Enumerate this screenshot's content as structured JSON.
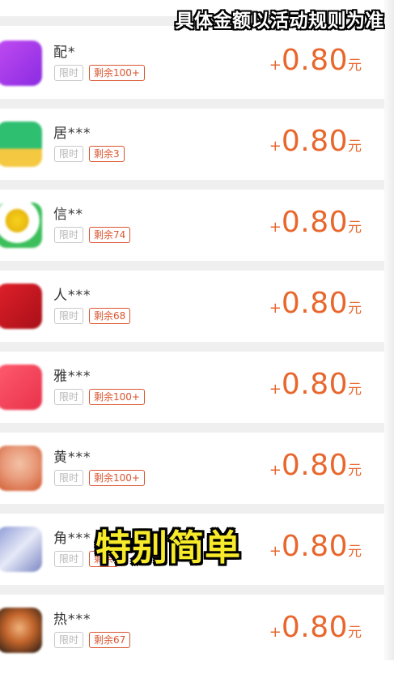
{
  "overlay": {
    "top_banner": "具体金额以活动规则为准",
    "caption": "特别简单"
  },
  "colors": {
    "accent": "#e8672d",
    "tag_border": "#d9552f",
    "caption_fill": "#f7ea2b"
  },
  "rewards": [
    {
      "name": "配*",
      "limit_tag": "限时",
      "remain_tag": "剩余100+",
      "plus": "+",
      "amount": "0.80",
      "unit": "元",
      "icon": "purple-app-icon"
    },
    {
      "name": "居***",
      "limit_tag": "限时",
      "remain_tag": "剩余3",
      "plus": "+",
      "amount": "0.80",
      "unit": "元",
      "icon": "green-app-icon"
    },
    {
      "name": "信**",
      "limit_tag": "限时",
      "remain_tag": "剩余74",
      "plus": "+",
      "amount": "0.80",
      "unit": "元",
      "icon": "sunflower-app-icon"
    },
    {
      "name": "人***",
      "limit_tag": "限时",
      "remain_tag": "剩余68",
      "plus": "+",
      "amount": "0.80",
      "unit": "元",
      "icon": "red-app-icon"
    },
    {
      "name": "雅***",
      "limit_tag": "限时",
      "remain_tag": "剩余100+",
      "plus": "+",
      "amount": "0.80",
      "unit": "元",
      "icon": "pink-app-icon"
    },
    {
      "name": "黄***",
      "limit_tag": "限时",
      "remain_tag": "剩余100+",
      "plus": "+",
      "amount": "0.80",
      "unit": "元",
      "icon": "avatar-app-icon"
    },
    {
      "name": "角***",
      "limit_tag": "限时",
      "remain_tag": "剩余",
      "plus": "+",
      "amount": "0.80",
      "unit": "元",
      "icon": "anime-app-icon"
    },
    {
      "name": "热***",
      "limit_tag": "限时",
      "remain_tag": "剩余67",
      "plus": "+",
      "amount": "0.80",
      "unit": "元",
      "icon": "game-app-icon"
    }
  ]
}
